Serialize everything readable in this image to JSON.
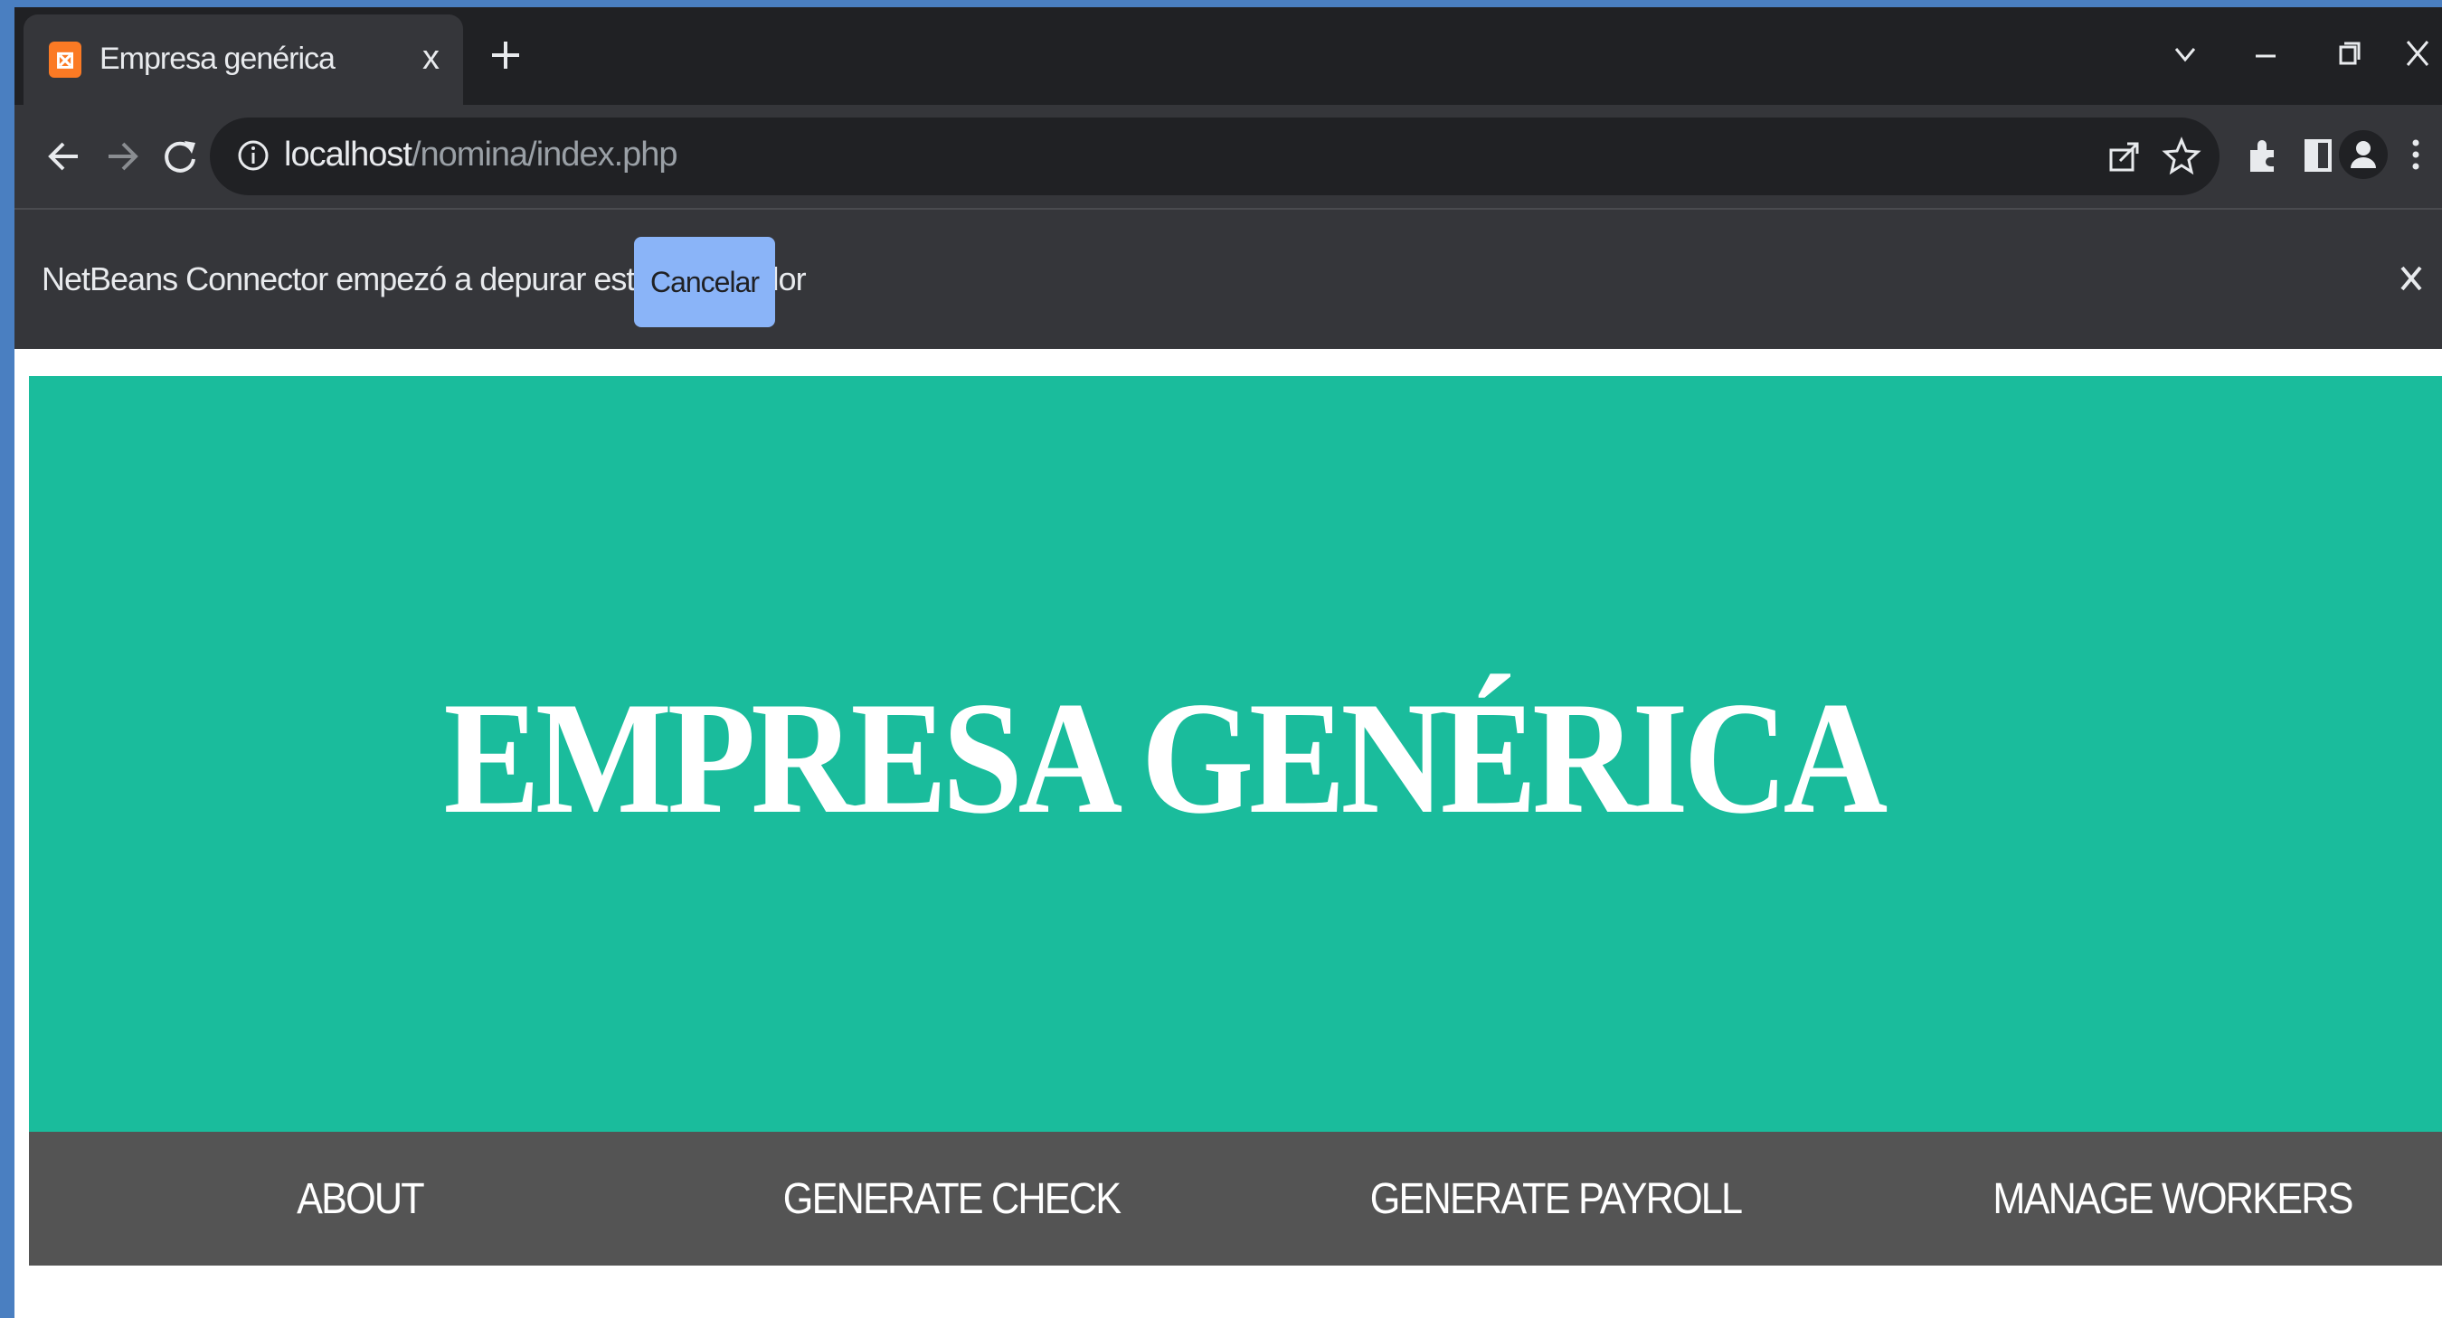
{
  "tab": {
    "title": "Empresa genérica",
    "close_glyph": "x",
    "favicon": "xampp-icon"
  },
  "window_controls": [
    "chevron-down-icon",
    "minimize-icon",
    "restore-icon",
    "close-icon"
  ],
  "toolbar": {
    "url_host": "localhost",
    "url_path": "/nomina/index.php"
  },
  "infobar": {
    "message": "NetBeans Connector empezó a depurar este navegador",
    "cancel_label": "Cancelar",
    "close_glyph": "X"
  },
  "site": {
    "title": "EMPRESA GENÉRICA",
    "nav": [
      {
        "label": "ABOUT"
      },
      {
        "label": "GENERATE CHECK"
      },
      {
        "label": "GENERATE PAYROLL"
      },
      {
        "label": "MANAGE WORKERS"
      }
    ]
  },
  "colors": {
    "hero_bg": "#1abc9c",
    "nav_bg": "#545454",
    "browser_chrome": "#35363a",
    "tabstrip": "#202124",
    "cancel_button": "#8ab4f8",
    "desktop_bg": "#4a7fc1"
  }
}
